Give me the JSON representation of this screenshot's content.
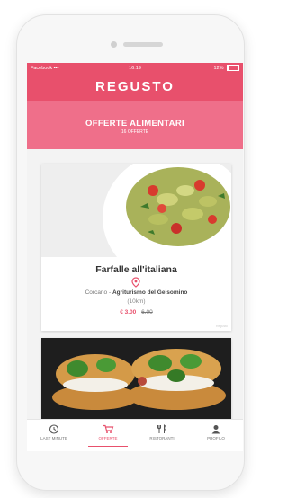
{
  "status_bar": {
    "carrier": "Facebook",
    "time": "16:19",
    "battery": "12%"
  },
  "app": {
    "title": "REGUSTO"
  },
  "banner": {
    "title": "OFFERTE ALIMENTARI",
    "subtitle": "16 OFFERTE"
  },
  "offer": {
    "title": "Farfalle all'italiana",
    "location_prefix": "Corcano -",
    "venue": "Agriturismo del Gelsomino",
    "distance": "(10km)",
    "price_new": "€ 3.00",
    "price_old": "6.00",
    "badge": "Regusto"
  },
  "tabs": [
    {
      "label": "LAST MINUTE",
      "icon": "clock-icon"
    },
    {
      "label": "OFFERTE",
      "icon": "cart-icon",
      "active": true
    },
    {
      "label": "RISTORANTI",
      "icon": "cutlery-icon"
    },
    {
      "label": "PROFILO",
      "icon": "user-icon"
    }
  ],
  "colors": {
    "accent": "#e8506c",
    "banner": "#ef6f8a"
  }
}
